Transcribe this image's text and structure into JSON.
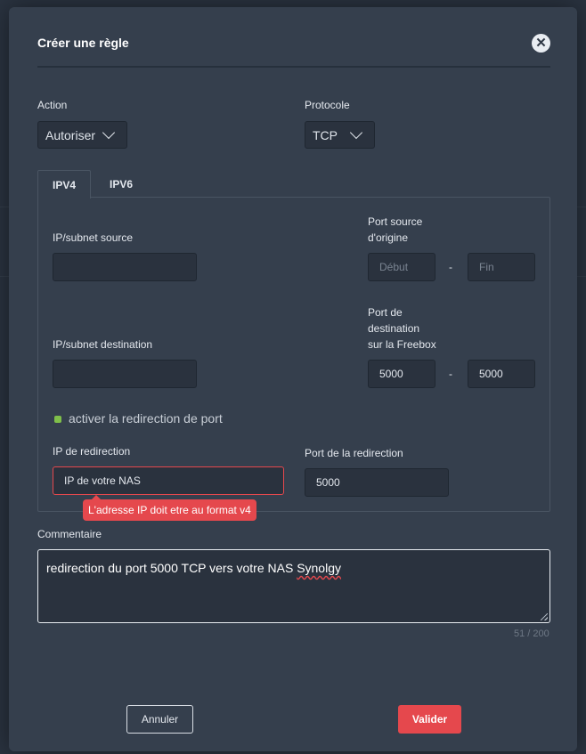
{
  "dialog": {
    "title": "Créer une règle",
    "close_icon": "close-icon"
  },
  "action": {
    "label": "Action",
    "value": "Autoriser"
  },
  "protocol": {
    "label": "Protocole",
    "value": "TCP"
  },
  "tabs": [
    {
      "label": "IPV4",
      "active": true
    },
    {
      "label": "IPV6",
      "active": false
    }
  ],
  "source": {
    "ip_label": "IP/subnet source",
    "ip_value": "",
    "port_label_line1": "Port source",
    "port_label_line2": "d'origine",
    "port_start_placeholder": "Début",
    "port_end_placeholder": "Fin",
    "dash": "-"
  },
  "destination": {
    "ip_label": "IP/subnet destination",
    "ip_value": "",
    "port_label_line1": "Port de",
    "port_label_line2": "destination",
    "port_label_line3": "sur la Freebox",
    "port_start": "5000",
    "port_end": "5000",
    "dash": "-"
  },
  "redirect": {
    "checkbox_label": "activer la redirection de port",
    "checked": true,
    "ip_label": "IP de redirection",
    "ip_value": "IP de votre NAS",
    "ip_error": "L'adresse IP doit etre au format v4",
    "port_label": "Port de la redirection",
    "port_value": "5000"
  },
  "comment": {
    "label": "Commentaire",
    "text_before": "redirection du port 5000 TCP vers votre NAS ",
    "text_misspelled": "Synolgy",
    "counter": "51 / 200"
  },
  "buttons": {
    "cancel": "Annuler",
    "submit": "Valider"
  },
  "colors": {
    "accent": "#e5484d",
    "check": "#7fbf4a",
    "modal_bg": "#353f4d"
  }
}
